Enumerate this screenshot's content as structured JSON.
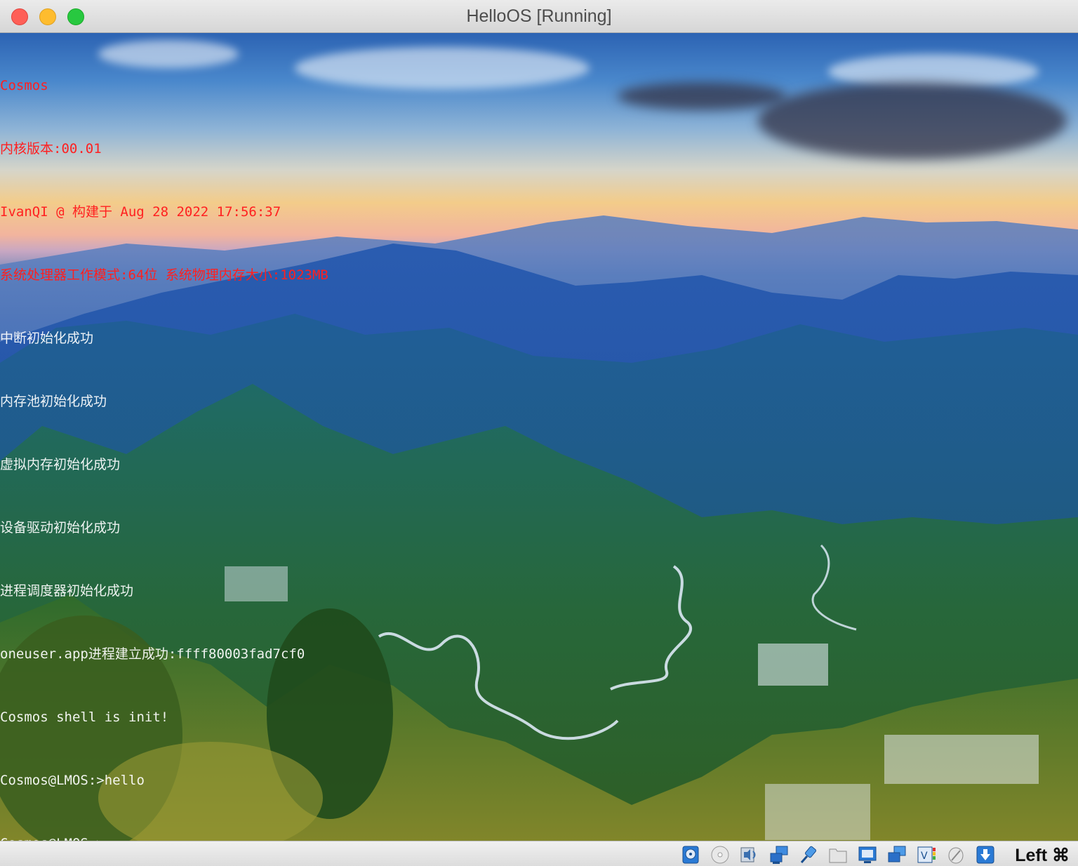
{
  "window": {
    "title": "HelloOS [Running]"
  },
  "console": {
    "lines": [
      {
        "text": "Cosmos",
        "color": "#ff2020"
      },
      {
        "text": "内核版本:00.01",
        "color": "#ff2020"
      },
      {
        "text": "IvanQI @ 构建于 Aug 28 2022 17:56:37",
        "color": "#ff2020"
      },
      {
        "text": "系统处理器工作模式:64位 系统物理内存大小:1023MB",
        "color": "#ff2020"
      },
      {
        "text": "中断初始化成功",
        "color": "#ffffff"
      },
      {
        "text": "内存池初始化成功",
        "color": "#ffffff"
      },
      {
        "text": "虚拟内存初始化成功",
        "color": "#ffffff"
      },
      {
        "text": "设备驱动初始化成功",
        "color": "#ffffff"
      },
      {
        "text": "进程调度器初始化成功",
        "color": "#ffffff"
      },
      {
        "text": "oneuser.app进程建立成功:ffff80003fad7cf0",
        "color": "#ffffff"
      },
      {
        "text": "Cosmos shell is init!",
        "color": "#ffffff"
      },
      {
        "text": "Cosmos@LMOS:>hello",
        "color": "#ffffff"
      },
      {
        "text": "Cosmos@LMOS:>",
        "color": "#ffffff"
      }
    ]
  },
  "statusbar": {
    "icons": [
      "hard-disk-icon",
      "optical-drive-icon",
      "audio-icon",
      "network-icon",
      "usb-icon",
      "shared-folder-icon",
      "display-icon",
      "capture-icon",
      "cpu-icon",
      "mouse-integration-icon",
      "keyboard-icon"
    ],
    "host_key": "Left ⌘"
  }
}
